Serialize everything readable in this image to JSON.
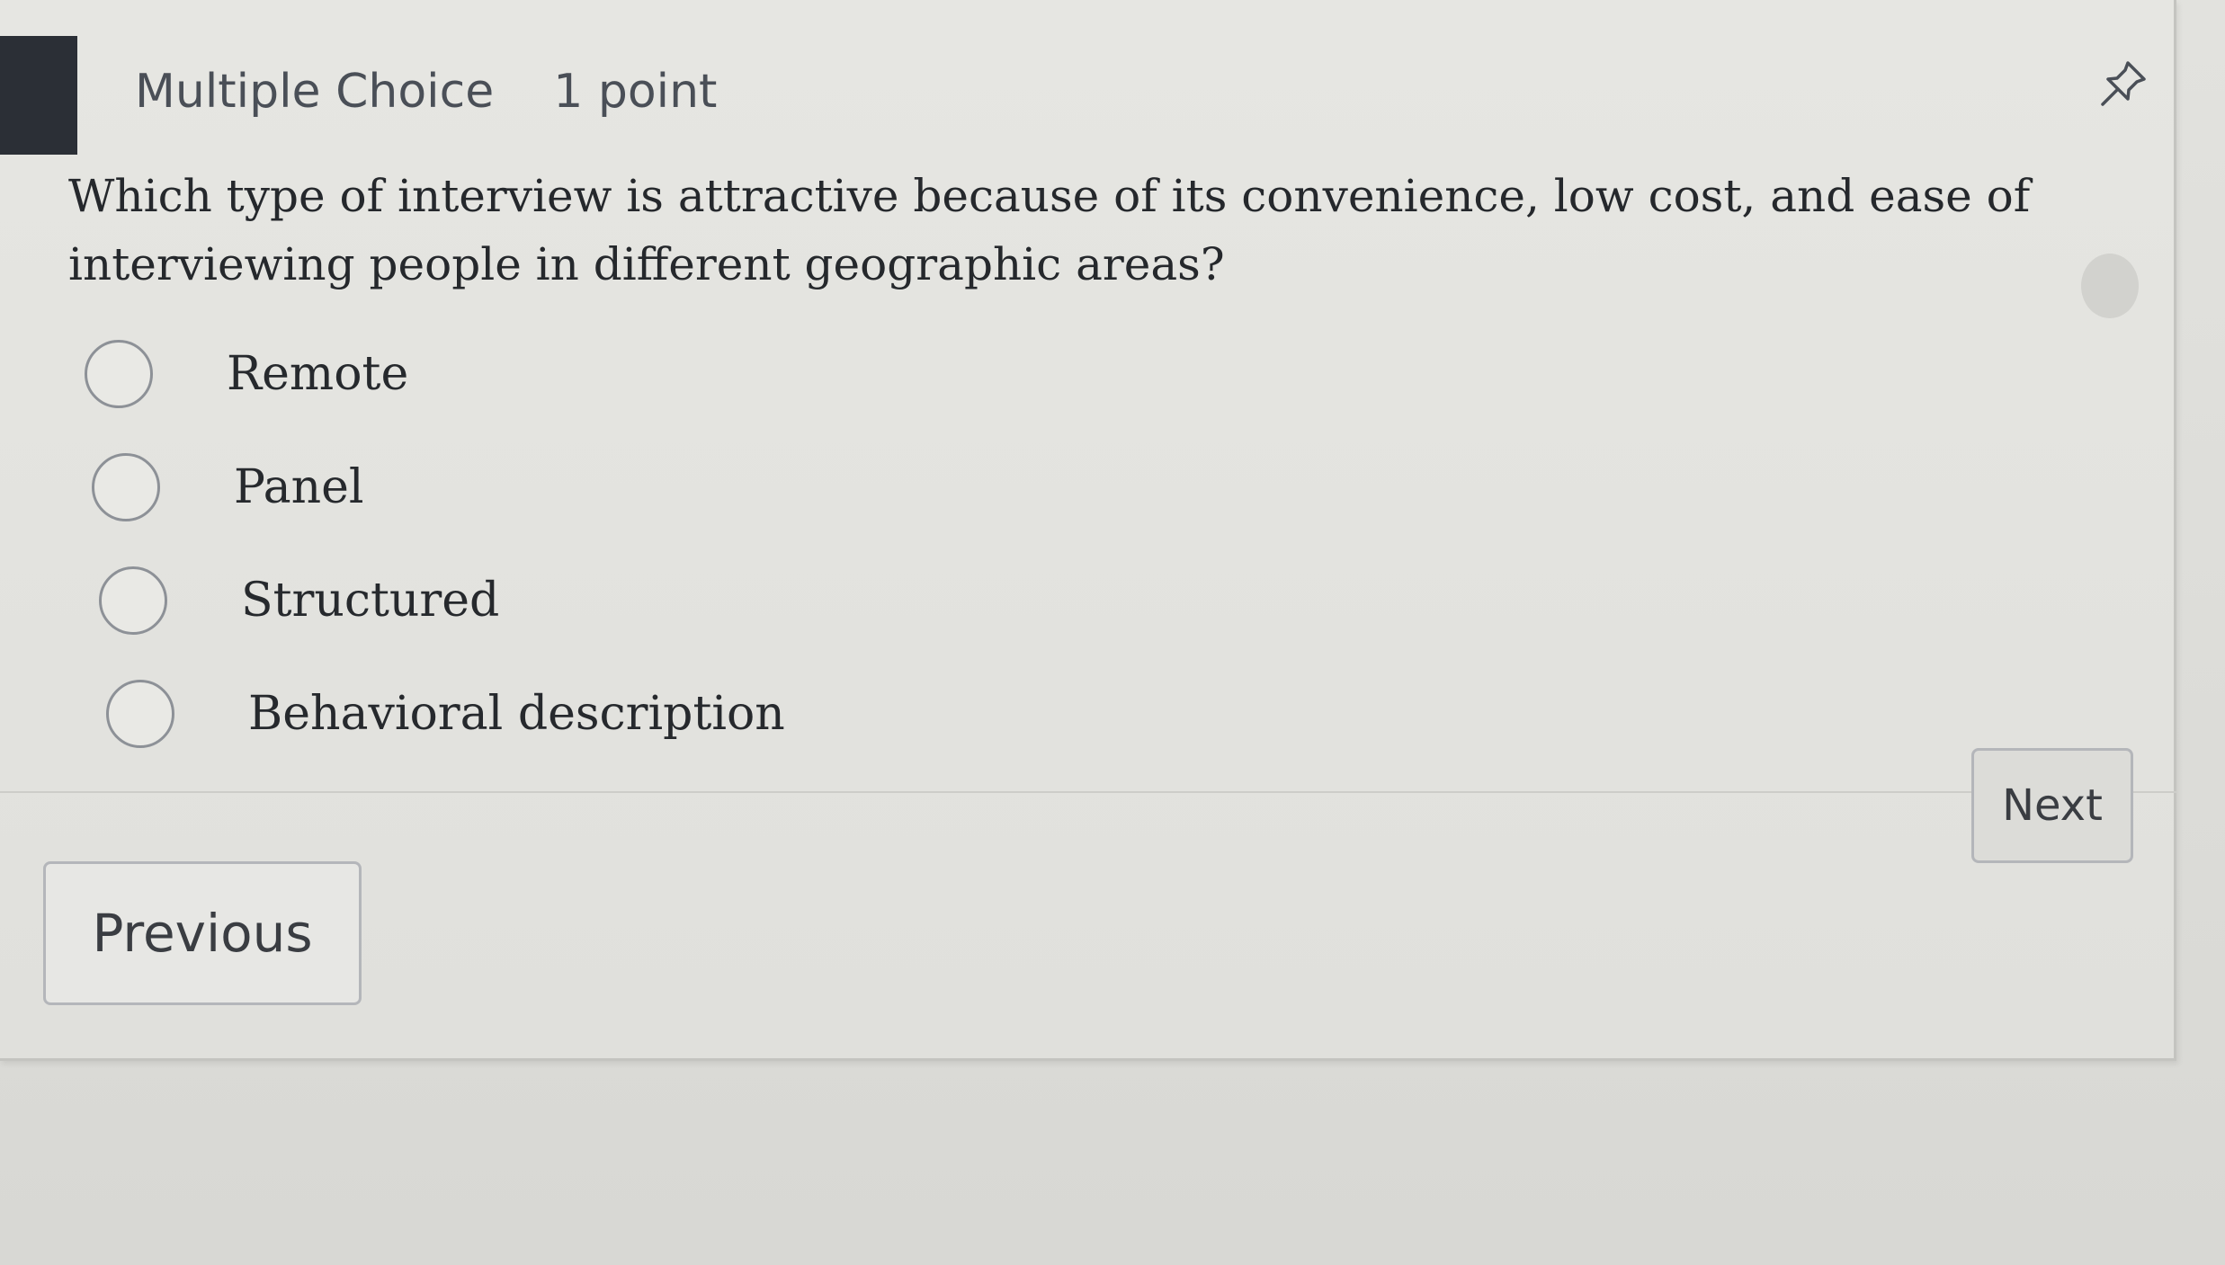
{
  "header": {
    "question_type": "Multiple Choice",
    "points": "1 point",
    "pin_icon": "pin-icon"
  },
  "question": {
    "text": "Which type of interview is attractive because of its convenience, low cost, and ease of interviewing people in different geographic areas?"
  },
  "options": [
    {
      "label": "Remote"
    },
    {
      "label": "Panel"
    },
    {
      "label": "Structured"
    },
    {
      "label": "Behavioral description"
    }
  ],
  "navigation": {
    "previous_label": "Previous",
    "next_label": "Next"
  },
  "colors": {
    "background": "#e2e2de",
    "text": "#25282c",
    "accent_block": "#2b2f36",
    "radio_border": "#8d9197"
  }
}
